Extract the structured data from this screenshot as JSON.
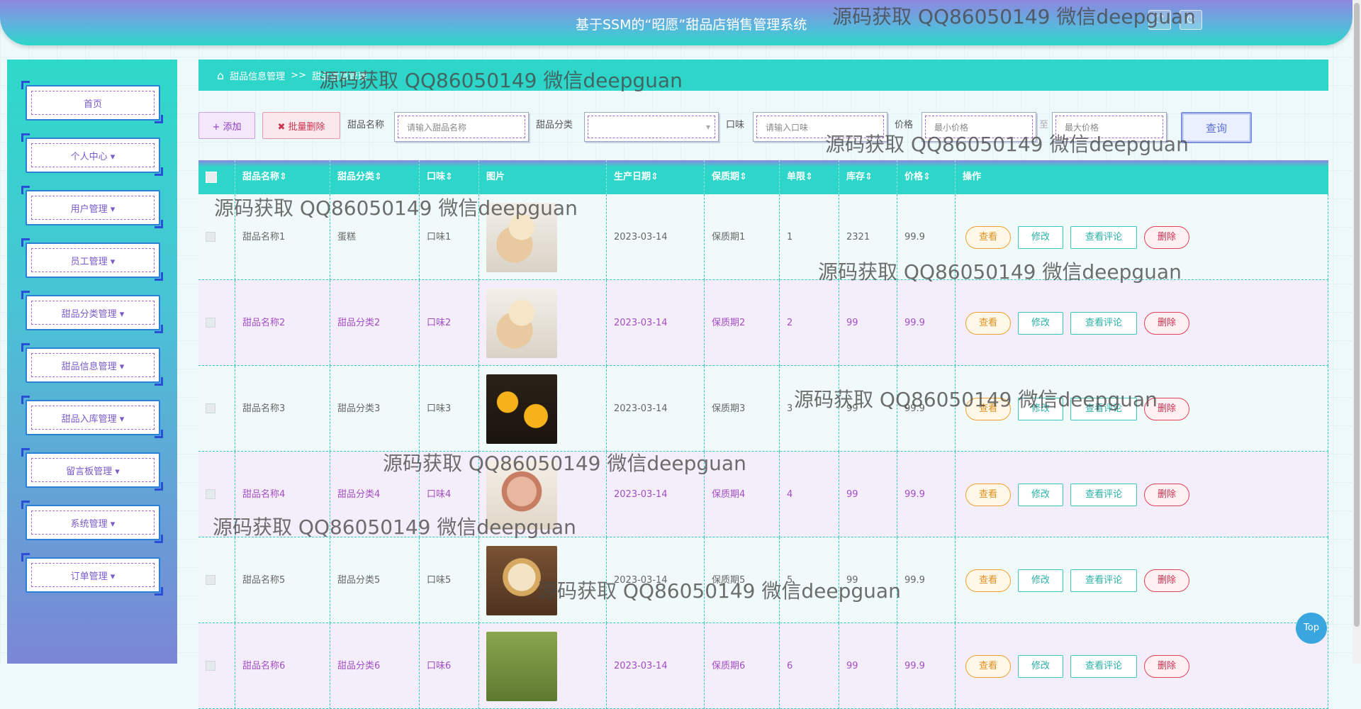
{
  "header": {
    "title": "基于SSM的“昭愿”甜品店销售管理系统"
  },
  "sidebar": {
    "items": [
      {
        "label": "首页"
      },
      {
        "label": "个人中心 ▾"
      },
      {
        "label": "用户管理 ▾"
      },
      {
        "label": "员工管理 ▾"
      },
      {
        "label": "甜品分类管理 ▾"
      },
      {
        "label": "甜品信息管理 ▾"
      },
      {
        "label": "甜品入库管理 ▾"
      },
      {
        "label": "留言板管理 ▾"
      },
      {
        "label": "系统管理 ▾"
      },
      {
        "label": "订单管理 ▾"
      }
    ]
  },
  "breadcrumb": {
    "root": "甜品信息管理",
    "sep": ">>",
    "current": "甜品信息管理"
  },
  "toolbar": {
    "add_label": "+ 添加",
    "batch_delete_label": "✖ 批量删除",
    "name_label": "甜品名称",
    "name_placeholder": "请输入甜品名称",
    "category_label": "甜品分类",
    "category_value": "",
    "taste_label": "口味",
    "taste_placeholder": "请输入口味",
    "price_label": "价格",
    "min_price_placeholder": "最小价格",
    "to_label": "至",
    "max_price_placeholder": "最大价格",
    "query_label": "查询"
  },
  "table": {
    "headers": [
      "甜品名称⇕",
      "甜品分类⇕",
      "口味⇕",
      "图片",
      "生产日期⇕",
      "保质期⇕",
      "单限⇕",
      "库存⇕",
      "价格⇕",
      "操作"
    ],
    "rows": [
      {
        "name": "甜品名称1",
        "category": "蛋糕",
        "taste": "口味1",
        "date": "2023-03-14",
        "shelf": "保质期1",
        "limit": "1",
        "stock": "2321",
        "price": "99.9"
      },
      {
        "name": "甜品名称2",
        "category": "甜品分类2",
        "taste": "口味2",
        "date": "2023-03-14",
        "shelf": "保质期2",
        "limit": "2",
        "stock": "99",
        "price": "99.9"
      },
      {
        "name": "甜品名称3",
        "category": "甜品分类3",
        "taste": "口味3",
        "date": "2023-03-14",
        "shelf": "保质期3",
        "limit": "3",
        "stock": "99",
        "price": "99.9"
      },
      {
        "name": "甜品名称4",
        "category": "甜品分类4",
        "taste": "口味4",
        "date": "2023-03-14",
        "shelf": "保质期4",
        "limit": "4",
        "stock": "99",
        "price": "99.9"
      },
      {
        "name": "甜品名称5",
        "category": "甜品分类5",
        "taste": "口味5",
        "date": "2023-03-14",
        "shelf": "保质期5",
        "limit": "5",
        "stock": "99",
        "price": "99.9"
      },
      {
        "name": "甜品名称6",
        "category": "甜品分类6",
        "taste": "口味6",
        "date": "2023-03-14",
        "shelf": "保质期6",
        "limit": "6",
        "stock": "99",
        "price": "99.9"
      }
    ],
    "actions": {
      "view": "查看",
      "edit": "修改",
      "comments": "查看评论",
      "delete": "删除"
    }
  },
  "watermark": "源码获取 QQ86050149 微信deepguan",
  "to_top_label": "Top",
  "colors": {
    "accent": "#2dd6c9",
    "purple": "#8e87e0",
    "nav_text": "#7a5ac8"
  }
}
